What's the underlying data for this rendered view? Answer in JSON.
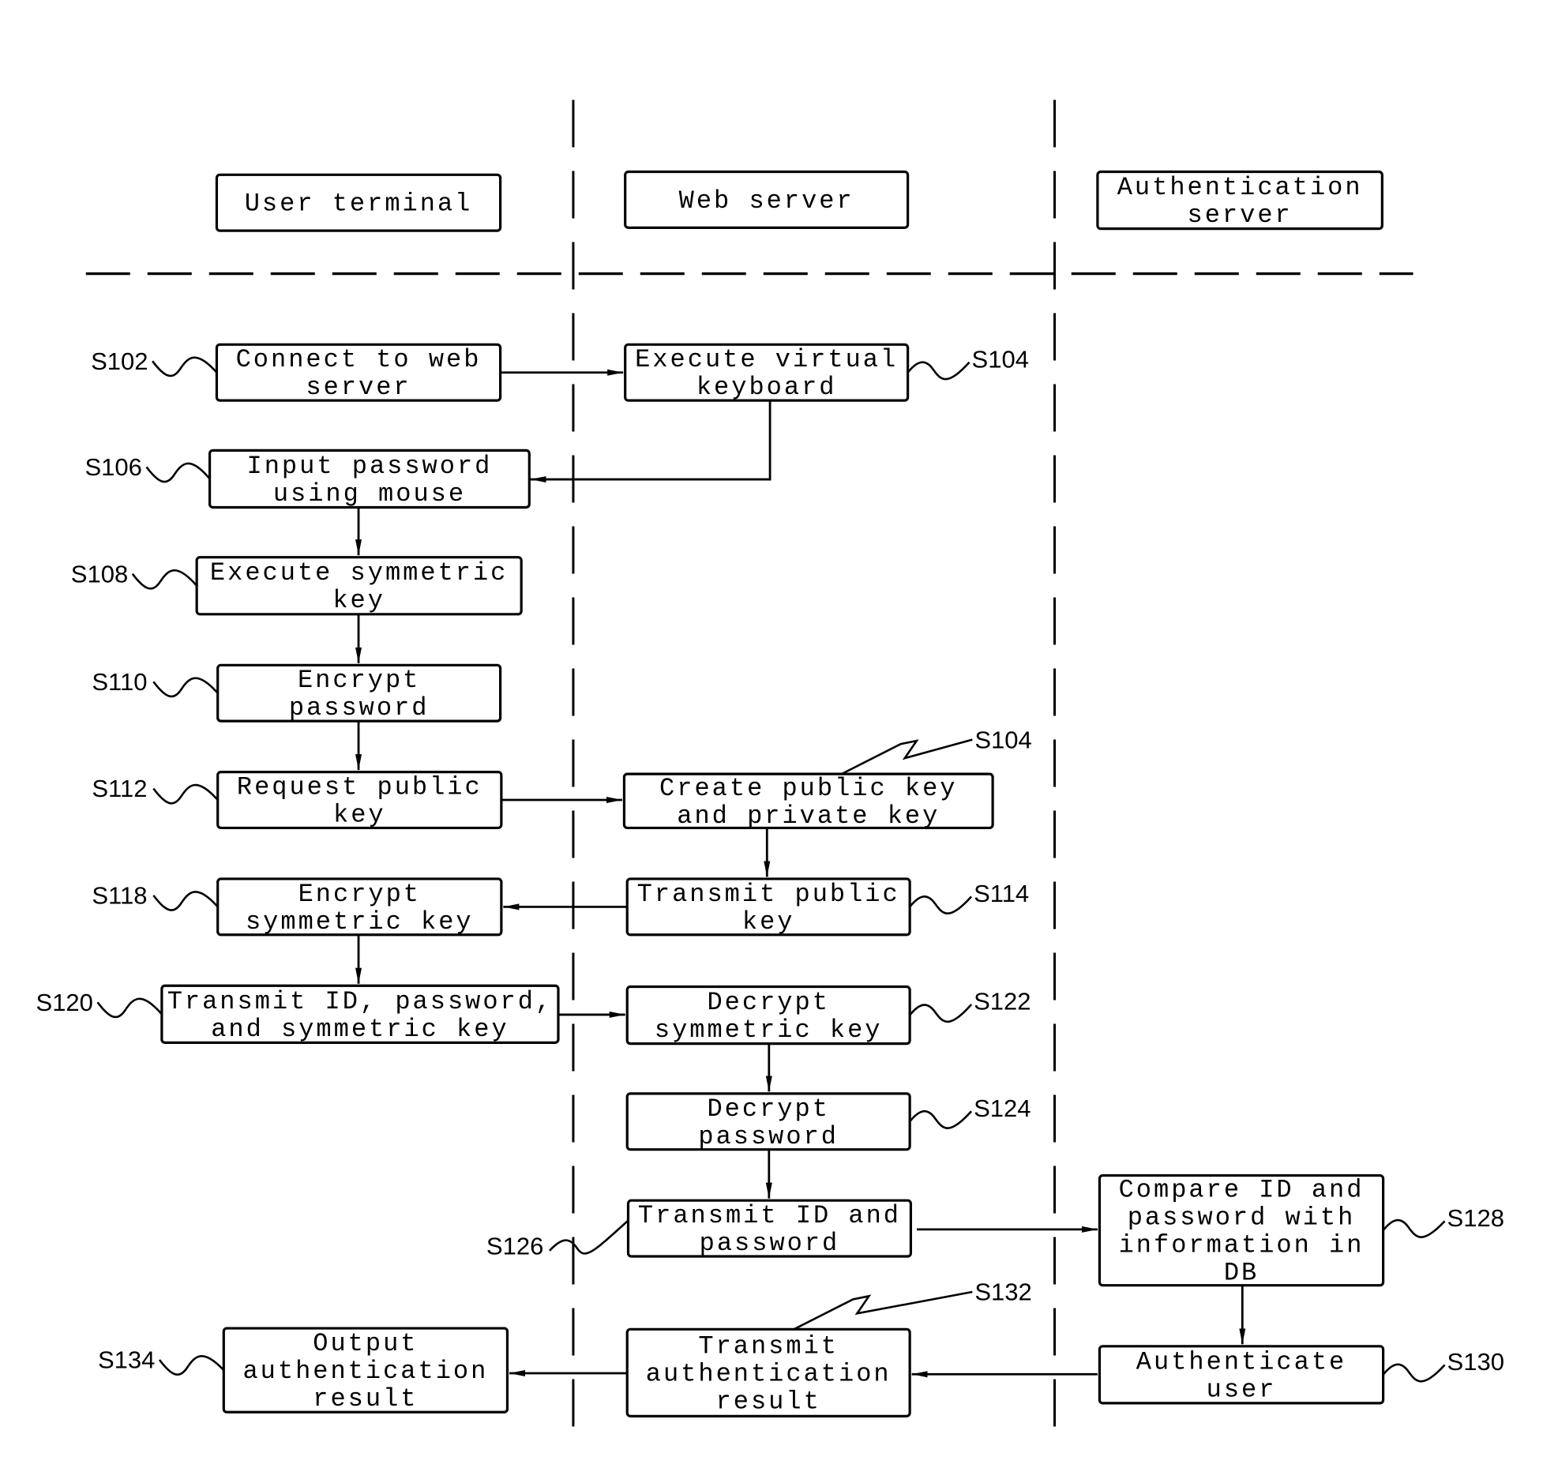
{
  "lanes": [
    {
      "id": "user",
      "label": [
        "User terminal"
      ]
    },
    {
      "id": "web",
      "label": [
        "Web server"
      ]
    },
    {
      "id": "auth",
      "label": [
        "Authentication",
        "server"
      ]
    }
  ],
  "steps": [
    {
      "id": "S102",
      "ref": "S102",
      "lane": "user",
      "lines": [
        "Connect to web",
        "server"
      ]
    },
    {
      "id": "S104a",
      "ref": "S104",
      "lane": "web",
      "lines": [
        "Execute virtual",
        "keyboard"
      ]
    },
    {
      "id": "S106",
      "ref": "S106",
      "lane": "user",
      "lines": [
        "Input password",
        "using mouse"
      ]
    },
    {
      "id": "S108",
      "ref": "S108",
      "lane": "user",
      "lines": [
        "Execute symmetric",
        "key"
      ]
    },
    {
      "id": "S110",
      "ref": "S110",
      "lane": "user",
      "lines": [
        "Encrypt",
        "password"
      ]
    },
    {
      "id": "S112",
      "ref": "S112",
      "lane": "user",
      "lines": [
        "Request public",
        "key"
      ]
    },
    {
      "id": "S104b",
      "ref": "S104",
      "lane": "web",
      "lines": [
        "Create public key",
        "and private key"
      ]
    },
    {
      "id": "S114",
      "ref": "S114",
      "lane": "web",
      "lines": [
        "Transmit public",
        "key"
      ]
    },
    {
      "id": "S118",
      "ref": "S118",
      "lane": "user",
      "lines": [
        "Encrypt",
        "symmetric key"
      ]
    },
    {
      "id": "S120",
      "ref": "S120",
      "lane": "user",
      "lines": [
        "Transmit ID, password,",
        "and symmetric key"
      ]
    },
    {
      "id": "S122",
      "ref": "S122",
      "lane": "web",
      "lines": [
        "Decrypt",
        "symmetric key"
      ]
    },
    {
      "id": "S124",
      "ref": "S124",
      "lane": "web",
      "lines": [
        "Decrypt",
        "password"
      ]
    },
    {
      "id": "S126",
      "ref": "S126",
      "lane": "web",
      "lines": [
        "Transmit ID and",
        "password"
      ]
    },
    {
      "id": "S128",
      "ref": "S128",
      "lane": "auth",
      "lines": [
        "Compare ID and",
        "password with",
        "information in",
        "DB"
      ]
    },
    {
      "id": "S130",
      "ref": "S130",
      "lane": "auth",
      "lines": [
        "Authenticate",
        "user"
      ]
    },
    {
      "id": "S132",
      "ref": "S132",
      "lane": "web",
      "lines": [
        "Transmit",
        "authentication",
        "result"
      ]
    },
    {
      "id": "S134",
      "ref": "S134",
      "lane": "user",
      "lines": [
        "Output",
        "authentication",
        "result"
      ]
    }
  ],
  "flows": [
    {
      "from": "S102",
      "to": "S104a"
    },
    {
      "from": "S104a",
      "to": "S106"
    },
    {
      "from": "S106",
      "to": "S108"
    },
    {
      "from": "S108",
      "to": "S110"
    },
    {
      "from": "S110",
      "to": "S112"
    },
    {
      "from": "S112",
      "to": "S104b"
    },
    {
      "from": "S104b",
      "to": "S114"
    },
    {
      "from": "S114",
      "to": "S118"
    },
    {
      "from": "S118",
      "to": "S120"
    },
    {
      "from": "S120",
      "to": "S122"
    },
    {
      "from": "S122",
      "to": "S124"
    },
    {
      "from": "S124",
      "to": "S126"
    },
    {
      "from": "S126",
      "to": "S128"
    },
    {
      "from": "S128",
      "to": "S130"
    },
    {
      "from": "S130",
      "to": "S132"
    },
    {
      "from": "S132",
      "to": "S134"
    }
  ]
}
